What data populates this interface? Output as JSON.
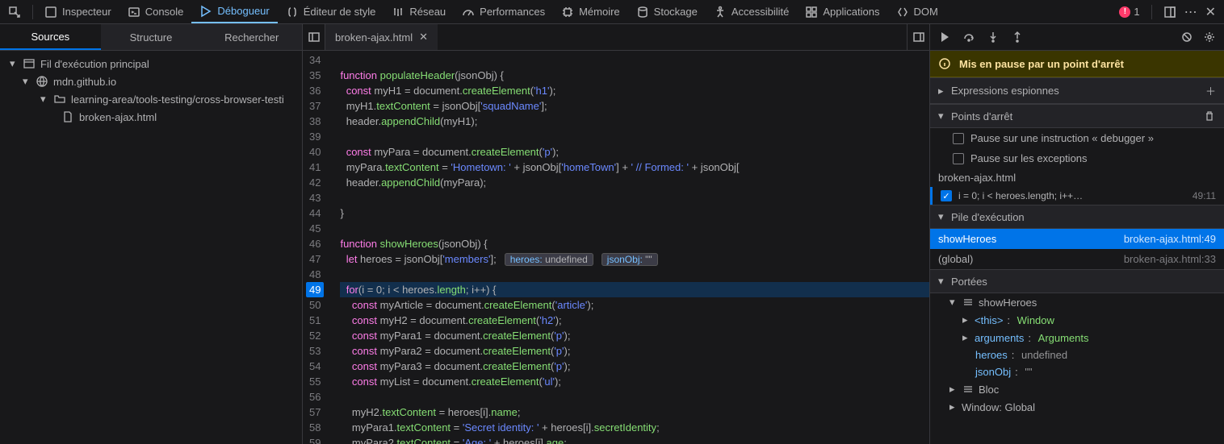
{
  "toolbar": {
    "tabs": [
      {
        "id": "inspector",
        "label": "Inspecteur"
      },
      {
        "id": "console",
        "label": "Console"
      },
      {
        "id": "debugger",
        "label": "Débogueur",
        "active": true
      },
      {
        "id": "style",
        "label": "Éditeur de style"
      },
      {
        "id": "network",
        "label": "Réseau"
      },
      {
        "id": "performance",
        "label": "Performances"
      },
      {
        "id": "memory",
        "label": "Mémoire"
      },
      {
        "id": "storage",
        "label": "Stockage"
      },
      {
        "id": "accessibility",
        "label": "Accessibilité"
      },
      {
        "id": "application",
        "label": "Applications"
      },
      {
        "id": "dom",
        "label": "DOM"
      }
    ],
    "error_count": "1"
  },
  "left": {
    "tabs": {
      "sources": "Sources",
      "outline": "Structure",
      "search": "Rechercher"
    },
    "tree": {
      "main_thread": "Fil d'exécution principal",
      "host": "mdn.github.io",
      "folder": "learning-area/tools-testing/cross-browser-testi",
      "file": "broken-ajax.html"
    }
  },
  "editor": {
    "open_file": "broken-ajax.html",
    "breakpoint_line": 49,
    "annotations": {
      "heroes_k": "heroes:",
      "heroes_v": "undefined",
      "json_k": "jsonObj:",
      "json_v": "\"\""
    },
    "lines": [
      {
        "n": 34,
        "html": ""
      },
      {
        "n": 35,
        "html": "<span class='kw'>function</span> <span class='fn'>populateHeader</span>(jsonObj) {"
      },
      {
        "n": 36,
        "html": "  <span class='kw'>const</span> myH1 = document.<span class='prop'>createElement</span>(<span class='str'>'h1'</span>);"
      },
      {
        "n": 37,
        "html": "  myH1.<span class='prop'>textContent</span> = jsonObj[<span class='str'>'squadName'</span>];"
      },
      {
        "n": 38,
        "html": "  header.<span class='prop'>appendChild</span>(myH1);"
      },
      {
        "n": 39,
        "html": ""
      },
      {
        "n": 40,
        "html": "  <span class='kw'>const</span> myPara = document.<span class='prop'>createElement</span>(<span class='str'>'p'</span>);"
      },
      {
        "n": 41,
        "html": "  myPara.<span class='prop'>textContent</span> = <span class='str'>'Hometown: '</span> + jsonObj[<span class='str'>'homeTown'</span>] + <span class='str'>' // Formed: '</span> + jsonObj["
      },
      {
        "n": 42,
        "html": "  header.<span class='prop'>appendChild</span>(myPara);"
      },
      {
        "n": 43,
        "html": ""
      },
      {
        "n": 44,
        "html": "}"
      },
      {
        "n": 45,
        "html": ""
      },
      {
        "n": 46,
        "html": "<span class='kw'>function</span> <span class='fn'>showHeroes</span>(jsonObj) {"
      },
      {
        "n": 47,
        "html": "  <span class='kw'>let</span> heroes = jsonObj[<span class='str'>'members'</span>];",
        "anno": true
      },
      {
        "n": 48,
        "html": ""
      },
      {
        "n": 49,
        "html": "  <span class='kw'>for</span>(i = 0; i &lt; heroes.<span class='prop'>length</span>; i++) {",
        "current": true
      },
      {
        "n": 50,
        "html": "    <span class='kw'>const</span> myArticle = document.<span class='prop'>createElement</span>(<span class='str'>'article'</span>);"
      },
      {
        "n": 51,
        "html": "    <span class='kw'>const</span> myH2 = document.<span class='prop'>createElement</span>(<span class='str'>'h2'</span>);"
      },
      {
        "n": 52,
        "html": "    <span class='kw'>const</span> myPara1 = document.<span class='prop'>createElement</span>(<span class='str'>'p'</span>);"
      },
      {
        "n": 53,
        "html": "    <span class='kw'>const</span> myPara2 = document.<span class='prop'>createElement</span>(<span class='str'>'p'</span>);"
      },
      {
        "n": 54,
        "html": "    <span class='kw'>const</span> myPara3 = document.<span class='prop'>createElement</span>(<span class='str'>'p'</span>);"
      },
      {
        "n": 55,
        "html": "    <span class='kw'>const</span> myList = document.<span class='prop'>createElement</span>(<span class='str'>'ul'</span>);"
      },
      {
        "n": 56,
        "html": ""
      },
      {
        "n": 57,
        "html": "    myH2.<span class='prop'>textContent</span> = heroes[i].<span class='prop'>name</span>;"
      },
      {
        "n": 58,
        "html": "    myPara1.<span class='prop'>textContent</span> = <span class='str'>'Secret identity: '</span> + heroes[i].<span class='prop'>secretIdentity</span>;"
      },
      {
        "n": 59,
        "html": "    myPara2.<span class='prop'>textContent</span> = <span class='str'>'Age: '</span> + heroes[i].<span class='prop'>age</span>;"
      }
    ]
  },
  "right": {
    "pause_msg": "Mis en pause par un point d'arrêt",
    "sections": {
      "watch": "Expressions espionnes",
      "breakpoints": "Points d'arrêt",
      "callstack": "Pile d'exécution",
      "scopes": "Portées"
    },
    "bp_opts": {
      "debugger": "Pause sur une instruction « debugger »",
      "exceptions": "Pause sur les exceptions"
    },
    "bp_file": "broken-ajax.html",
    "bp_code": "i = 0; i < heroes.length; i++…",
    "bp_loc": "49:11",
    "stack": [
      {
        "fn": "showHeroes",
        "loc": "broken-ajax.html:49",
        "sel": true
      },
      {
        "fn": "(global)",
        "loc": "broken-ajax.html:33"
      }
    ],
    "scopes": {
      "fn": "showHeroes",
      "this_label": "<this>",
      "this_val": "Window",
      "args_label": "arguments",
      "args_val": "Arguments",
      "heroes_label": "heroes",
      "heroes_val": "undefined",
      "json_label": "jsonObj",
      "json_val": "\"\"",
      "block": "Bloc",
      "window": "Window: Global"
    }
  }
}
